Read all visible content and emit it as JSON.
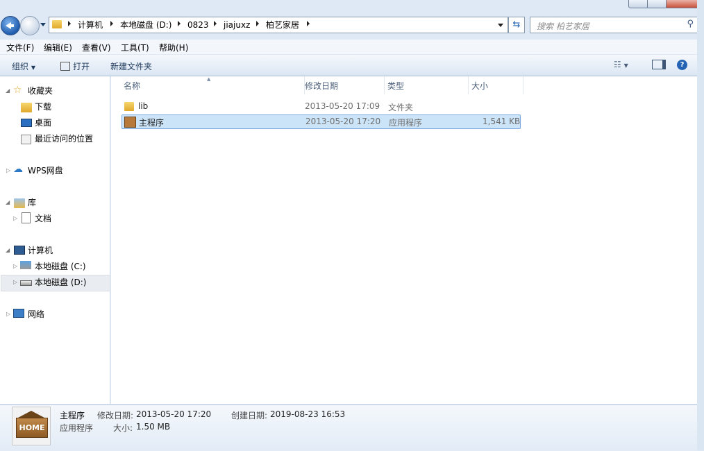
{
  "window": {
    "controls": [
      "minimize",
      "maximize",
      "close"
    ]
  },
  "address": {
    "crumbs": [
      "计算机",
      "本地磁盘 (D:)",
      "0823",
      "jiajuxz",
      "柏艺家居"
    ]
  },
  "search": {
    "placeholder": "搜索 柏艺家居"
  },
  "menu": [
    "文件(F)",
    "编辑(E)",
    "查看(V)",
    "工具(T)",
    "帮助(H)"
  ],
  "toolbar": {
    "organize": "组织",
    "open": "打开",
    "new_folder": "新建文件夹"
  },
  "nav": {
    "favorites": "收藏夹",
    "fav_items": [
      "下载",
      "桌面",
      "最近访问的位置"
    ],
    "wps": "WPS网盘",
    "library": "库",
    "lib_items": [
      "文档"
    ],
    "computer": "计算机",
    "drives": [
      "本地磁盘 (C:)",
      "本地磁盘 (D:)"
    ],
    "network": "网络"
  },
  "columns": [
    "名称",
    "修改日期",
    "类型",
    "大小"
  ],
  "files": [
    {
      "name": "lib",
      "date": "2013-05-20 17:09",
      "type": "文件夹",
      "size": ""
    },
    {
      "name": "主程序",
      "date": "2013-05-20 17:20",
      "type": "应用程序",
      "size": "1,541 KB"
    }
  ],
  "details": {
    "name": "主程序",
    "type": "应用程序",
    "modified_label": "修改日期:",
    "modified": "2013-05-20 17:20",
    "created_label": "创建日期:",
    "created": "2019-08-23 16:53",
    "size_label": "大小:",
    "size": "1.50 MB",
    "thumb_text": "HOME"
  },
  "colors": {
    "accent": "#1d5fb0",
    "selection": "#cce4f7",
    "selection_border": "#7aa7dd"
  }
}
